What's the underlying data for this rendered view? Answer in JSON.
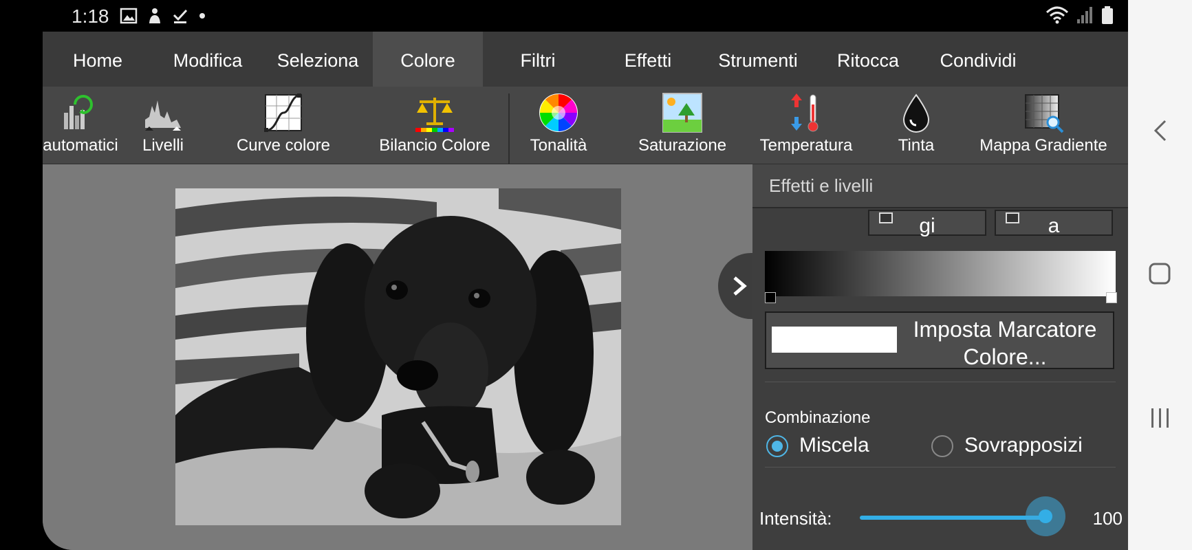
{
  "status_bar": {
    "time": "1:18"
  },
  "tabs": [
    "Home",
    "Modifica",
    "Seleziona",
    "Colore",
    "Filtri",
    "Effetti",
    "Strumenti",
    "Ritocca",
    "Condividi"
  ],
  "active_tab": "Colore",
  "ribbon": {
    "items": [
      "automatici",
      "Livelli",
      "Curve colore",
      "Bilancio Colore",
      "Tonalità",
      "Saturazione",
      "Temperatura",
      "Tinta",
      "Mappa Gradiente"
    ],
    "icons": [
      "auto-levels-icon",
      "levels-icon",
      "curves-icon",
      "balance-scale-icon",
      "color-wheel-icon",
      "saturation-icon",
      "thermometer-icon",
      "tint-drop-icon",
      "gradient-map-icon"
    ]
  },
  "panel": {
    "title": "Effetti e livelli",
    "swatch_buttons": [
      "gi",
      "a"
    ],
    "gradient": {
      "start_color": "#000000",
      "end_color": "#ffffff"
    },
    "set_marker_button": "Imposta Marcatore Colore...",
    "combination_label": "Combinazione",
    "radio_options": [
      {
        "label": "Miscela",
        "selected": true
      },
      {
        "label": "Sovrapposizi",
        "selected": false
      }
    ],
    "intensity_label": "Intensità:",
    "intensity_value": "100",
    "intensity_fraction": 1.0
  },
  "colors": {
    "accent": "#33aee6",
    "tab_bar": "#3a3a3a",
    "ribbon": "#474747",
    "panel": "#3e3e3e",
    "canvas": "#7a7a7a"
  }
}
